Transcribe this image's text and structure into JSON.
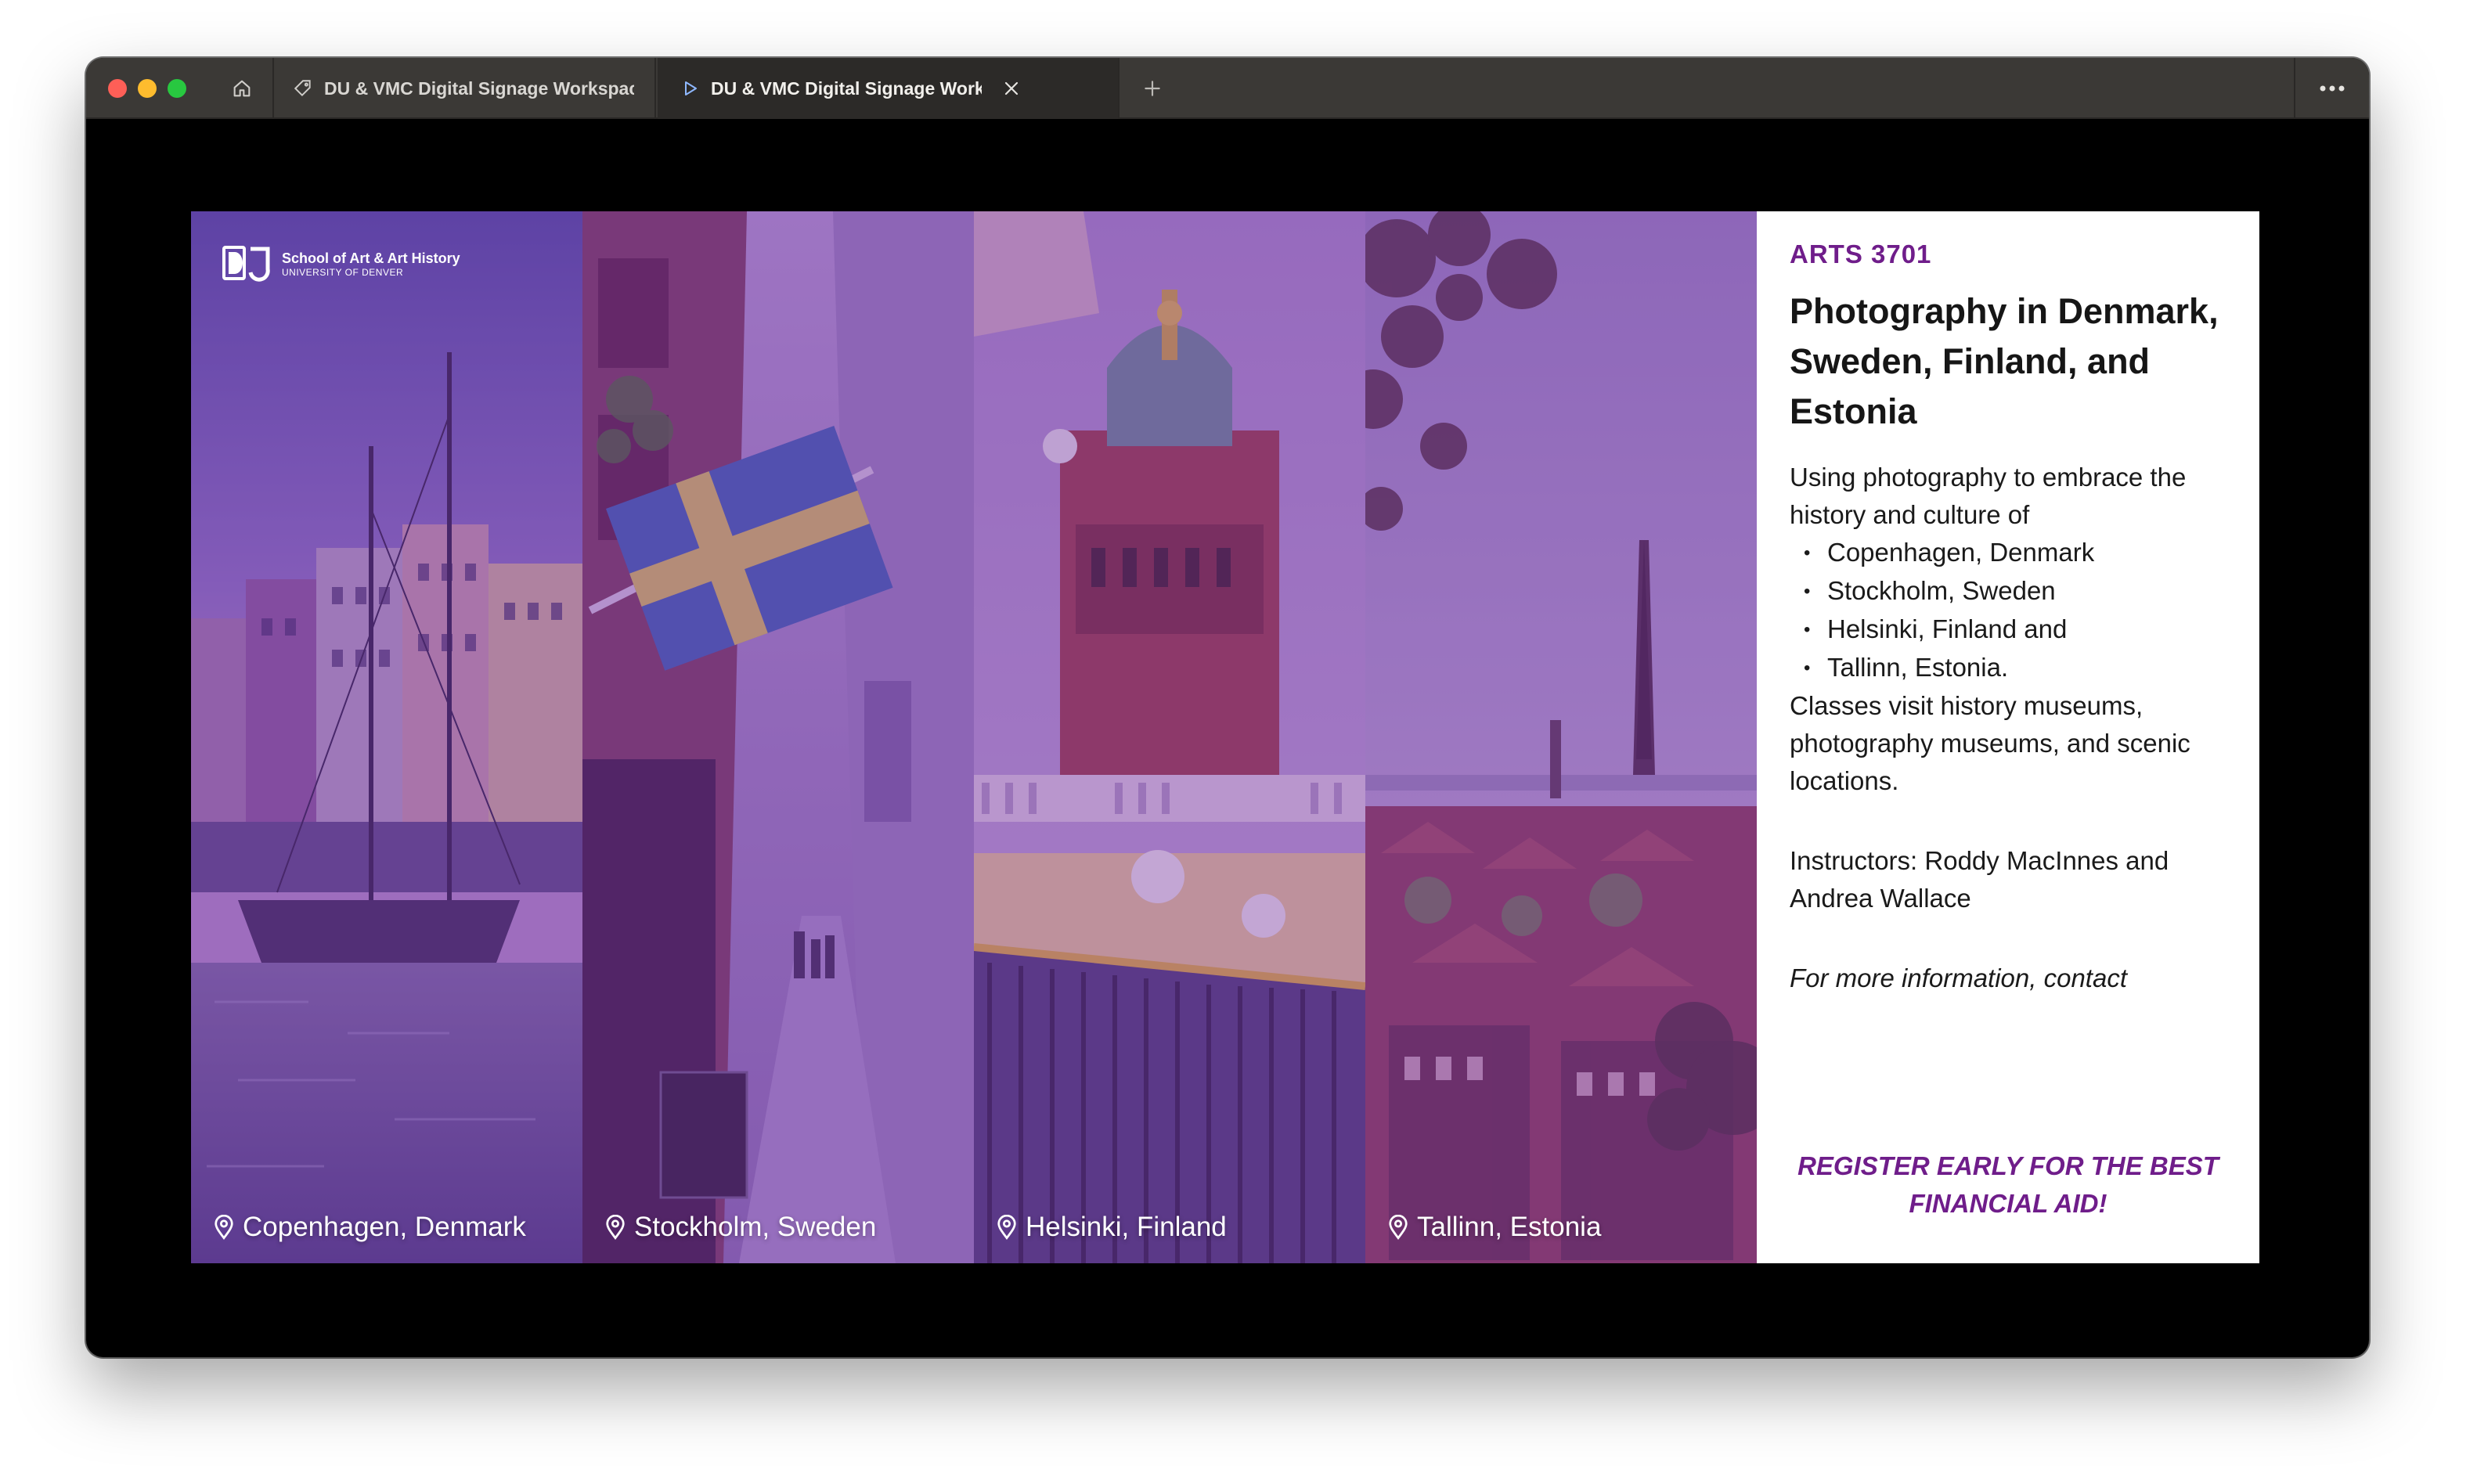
{
  "browser": {
    "tabs": [
      {
        "title": "DU & VMC Digital Signage Workspace",
        "active": false
      },
      {
        "title": "DU & VMC Digital Signage Workspace",
        "active": true
      }
    ],
    "icons": {
      "home": "home-icon",
      "tab1": "tag-icon",
      "tab2": "play-icon",
      "close": "close-icon",
      "new_tab": "plus-icon",
      "menu": "more-icon"
    }
  },
  "signage": {
    "logo": {
      "line1": "School of Art & Art History",
      "line2": "UNIVERSITY OF DENVER",
      "mark": "DU"
    },
    "panels": [
      {
        "location": "Copenhagen, Denmark"
      },
      {
        "location": "Stockholm, Sweden"
      },
      {
        "location": "Helsinki, Finland"
      },
      {
        "location": "Tallinn, Estonia"
      }
    ],
    "course_code": "ARTS 3701",
    "title": "Photography in Denmark, Sweden, Finland, and Estonia",
    "description_intro": "Using photography to embrace the history and culture of",
    "cities": [
      "Copenhagen, Denmark",
      "Stockholm, Sweden",
      "Helsinki, Finland and",
      "Tallinn, Estonia."
    ],
    "description_outro": "Classes visit history museums, photography museums, and scenic locations.",
    "instructors": "Instructors: Roddy MacInnes and Andrea Wallace",
    "contact": "For more information, contact",
    "register": "REGISTER EARLY FOR THE BEST FINANCIAL AID!",
    "colors": {
      "accent": "#6f1d8a",
      "overlay": "#7838a0"
    }
  }
}
